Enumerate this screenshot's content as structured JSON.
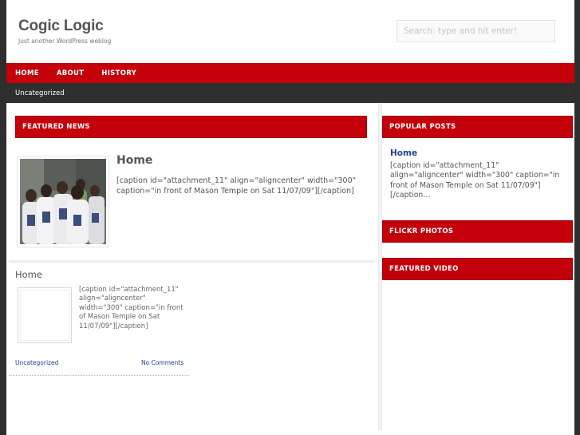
{
  "header": {
    "site_title": "Cogic Logic",
    "site_description": "Just another WordPress weblog",
    "search_placeholder": "Search: type and hit enter!"
  },
  "nav": {
    "main_items": [
      "HOME",
      "ABOUT",
      "HISTORY"
    ],
    "sub_items": [
      "Uncategorized"
    ]
  },
  "featured": {
    "heading": "FEATURED NEWS",
    "title": "Home",
    "excerpt": "[caption id=\"attachment_11\" align=\"aligncenter\" width=\"300\" caption=\"in front of Mason Temple on Sat 11/07/09\"][/caption]"
  },
  "post": {
    "title": "Home",
    "excerpt": "[caption id=\"attachment_11\" align=\"aligncenter\" width=\"300\" caption=\"in front of Mason Temple on Sat 11/07/09\"][/caption]",
    "category": "Uncategorized",
    "comments": "No Comments"
  },
  "sidebar": {
    "popular_heading": "POPULAR POSTS",
    "popular_title": "Home",
    "popular_excerpt": "[caption id=\"attachment_11\" align=\"aligncenter\" width=\"300\" caption=\"in front of Mason Temple on Sat 11/07/09\"][/caption…",
    "flickr_heading": "FLICKR PHOTOS",
    "video_heading": "FEATURED VIDEO"
  },
  "colors": {
    "accent_red": "#c4000b",
    "subnav_dark": "#2f2f2f",
    "link_blue": "#1f3f99"
  }
}
